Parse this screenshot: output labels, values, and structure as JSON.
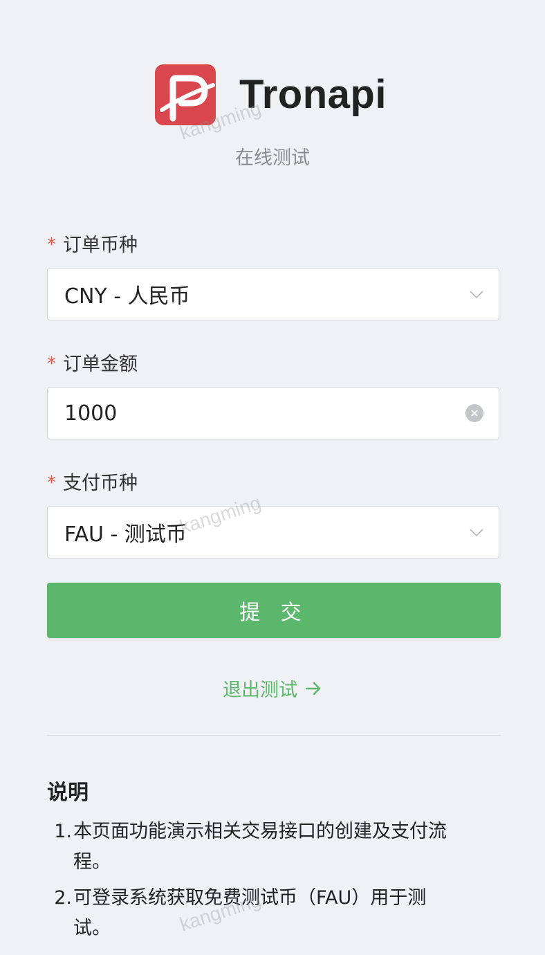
{
  "header": {
    "brand_name": "Tronapi",
    "subtitle": "在线测试"
  },
  "form": {
    "currency": {
      "required_mark": "*",
      "label": "订单币种",
      "value": "CNY - 人民币"
    },
    "amount": {
      "required_mark": "*",
      "label": "订单金额",
      "value": "1000"
    },
    "pay_currency": {
      "required_mark": "*",
      "label": "支付币种",
      "value": "FAU - 测试币"
    },
    "submit_label": "提 交",
    "exit_label": "退出测试"
  },
  "notes": {
    "title": "说明",
    "items": [
      {
        "num": "1.",
        "text": "本页面功能演示相关交易接口的创建及支付流程。"
      },
      {
        "num": "2.",
        "text": "可登录系统获取免费测试币（FAU）用于测试。"
      }
    ]
  },
  "watermark": "kangming",
  "colors": {
    "accent": "#5ab76c",
    "logo": "#d9464e",
    "required": "#f05a4f",
    "background": "#f0f1f5"
  },
  "icons": {
    "select_arrow": "chevron-down-icon",
    "clear": "clear-icon",
    "exit": "arrow-right-icon"
  }
}
